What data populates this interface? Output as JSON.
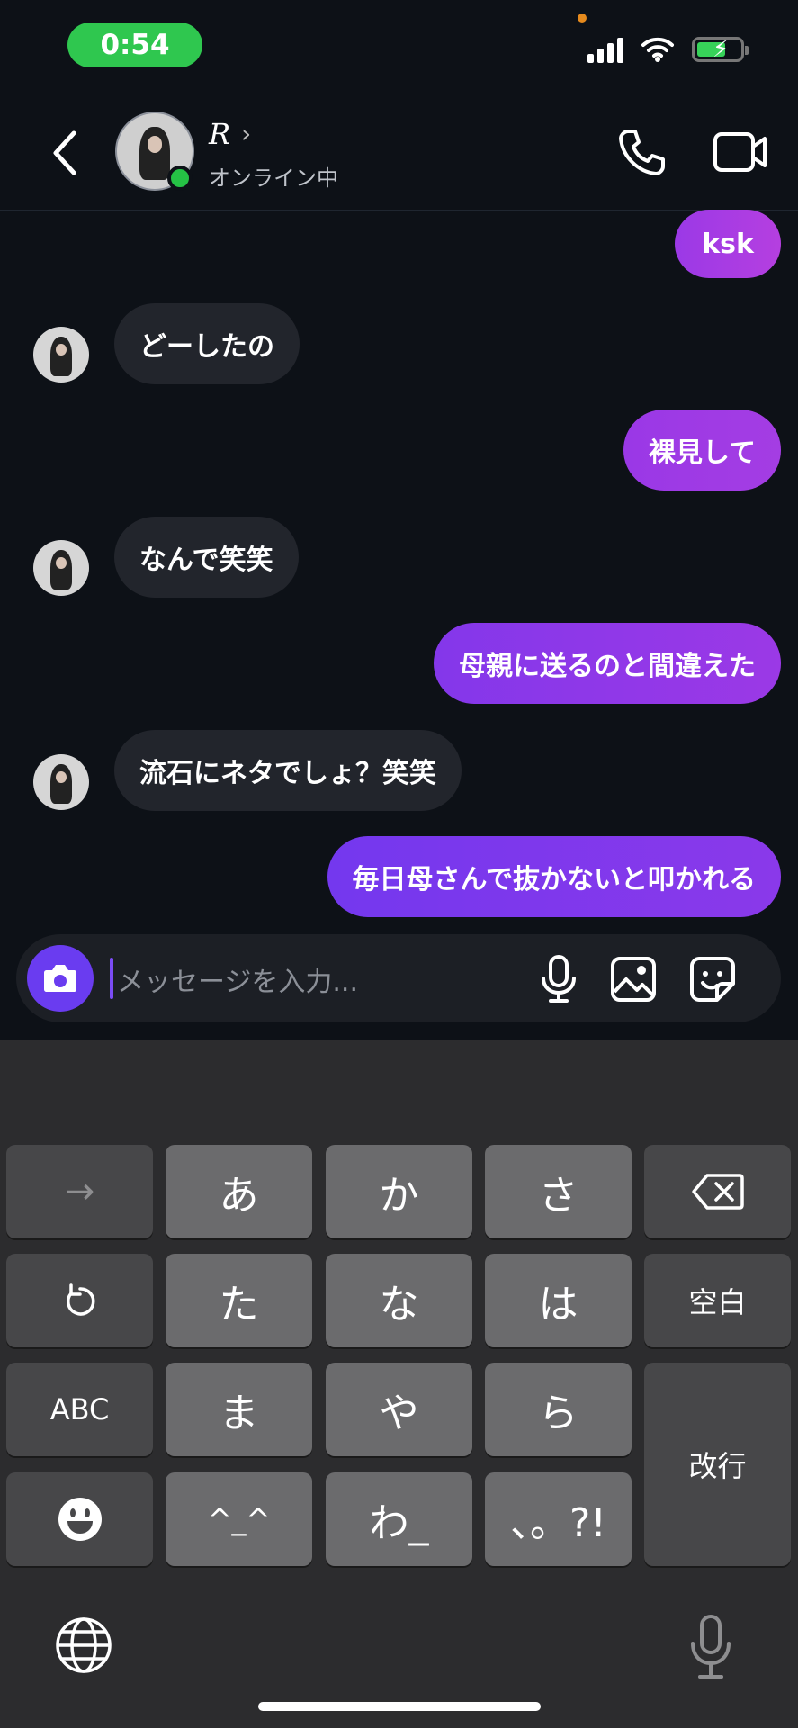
{
  "status_bar": {
    "time": "0:54"
  },
  "header": {
    "name": "R",
    "status": "オンライン中"
  },
  "messages": [
    {
      "side": "out",
      "text": "ksk"
    },
    {
      "side": "in",
      "text": "どーしたの"
    },
    {
      "side": "out",
      "text": "裸見して"
    },
    {
      "side": "in",
      "text": "なんで笑笑"
    },
    {
      "side": "out",
      "text": "母親に送るのと間違えた"
    },
    {
      "side": "in",
      "text": "流石にネタでしょ？笑笑"
    },
    {
      "side": "out",
      "text": "毎日母さんで抜かないと叩かれる"
    }
  ],
  "input": {
    "placeholder": "メッセージを入力..."
  },
  "keyboard": {
    "row1": [
      "→",
      "あ",
      "か",
      "さ"
    ],
    "row2": [
      "た",
      "な",
      "は",
      "空白"
    ],
    "row3": [
      "ABC",
      "ま",
      "や",
      "ら",
      "改行"
    ],
    "row4": [
      "^_^",
      "わ_",
      "、。?!"
    ]
  },
  "colors": {
    "online": "#25c245",
    "accent": "#6a3cf0",
    "bubble_out_gradient": [
      "#b43ee0",
      "#6e3cf2"
    ],
    "bubble_in": "#22252c"
  }
}
